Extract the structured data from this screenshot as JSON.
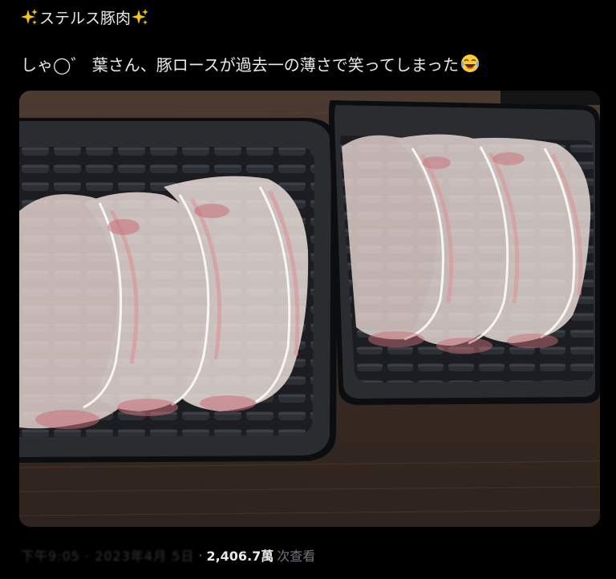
{
  "tweet": {
    "author_name": "ステルス豚肉",
    "author_decoration_icon": "sparkles-icon",
    "text": "しゃ◯゛ 葉さん、豚ロースが過去一の薄さで笑ってしまった",
    "text_emoji_icon": "face-with-tears-of-joy-icon",
    "media": {
      "icon": "photo-two-trays-of-thin-pork-slices"
    },
    "timestamp": "下午9:05 · 2023年4月 5日",
    "views_count": "2,406.7萬",
    "views_label": "次查看"
  },
  "colors": {
    "background": "#000000",
    "text_primary": "#e7e9ea",
    "text_secondary": "#71767b",
    "sparkle": "#f5c518"
  }
}
